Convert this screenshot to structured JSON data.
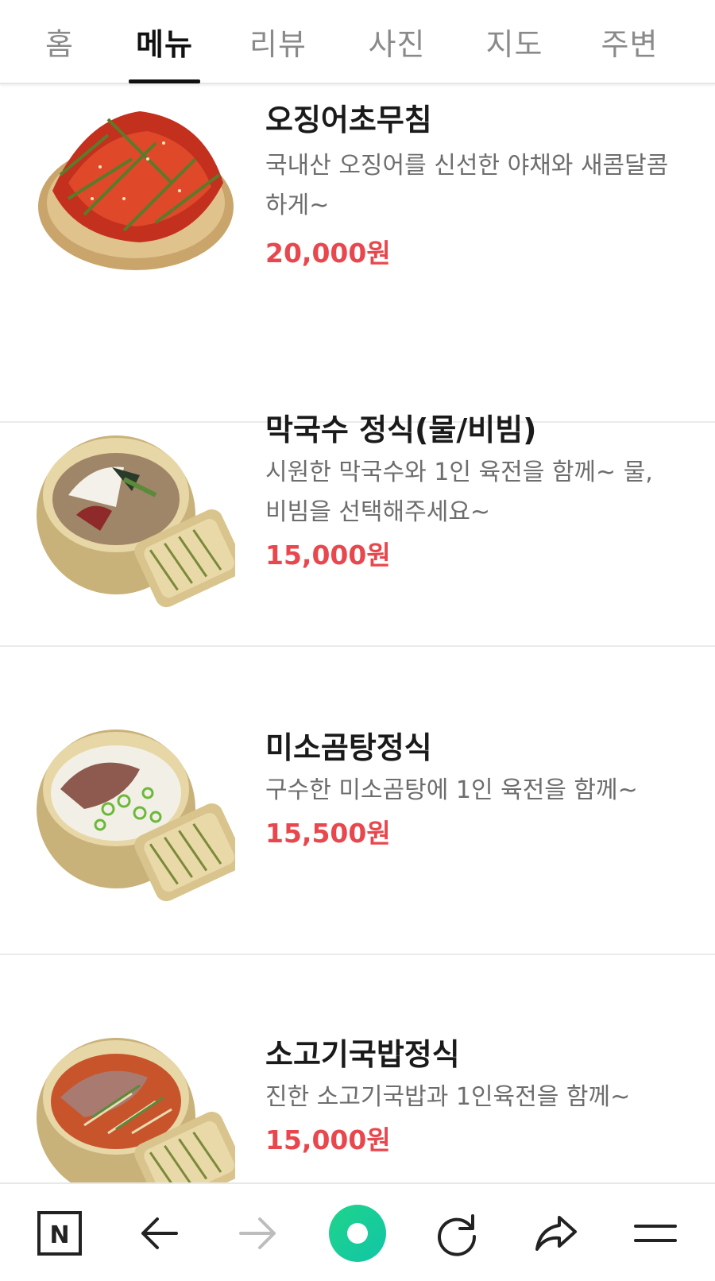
{
  "tabs": [
    {
      "label": "홈",
      "active": false
    },
    {
      "label": "메뉴",
      "active": true
    },
    {
      "label": "리뷰",
      "active": false
    },
    {
      "label": "사진",
      "active": false
    },
    {
      "label": "지도",
      "active": false
    },
    {
      "label": "주변",
      "active": false
    }
  ],
  "menu": [
    {
      "name": "오징어초무침",
      "desc": "국내산 오징어를 신선한 야채와 새콤달콤하게~",
      "price": "20,000원",
      "image": "squid-salad-photo"
    },
    {
      "name": "막국수 정식(물/비빔)",
      "desc": "시원한 막국수와 1인 육전을 함께~ 물, 비빔을 선택해주세요~",
      "price": "15,000원",
      "image": "buckwheat-noodle-set-photo"
    },
    {
      "name": "미소곰탕정식",
      "desc": "구수한 미소곰탕에 1인 육전을 함께~",
      "price": "15,500원",
      "image": "beef-bone-soup-set-photo"
    },
    {
      "name": "소고기국밥정식",
      "desc": "진한 소고기국밥과 1인육전을 함께~",
      "price": "15,000원",
      "image": "beef-rice-soup-set-photo"
    }
  ],
  "bottom_nav": {
    "icons": [
      "naver-home-icon",
      "back-arrow-icon",
      "forward-arrow-icon",
      "green-dot-icon",
      "reload-icon",
      "share-icon",
      "menu-icon"
    ]
  },
  "colors": {
    "price": "#e8474d",
    "active_tab": "#111111",
    "inactive_tab": "#8a8a8a",
    "green_dot": "#19ce60"
  }
}
